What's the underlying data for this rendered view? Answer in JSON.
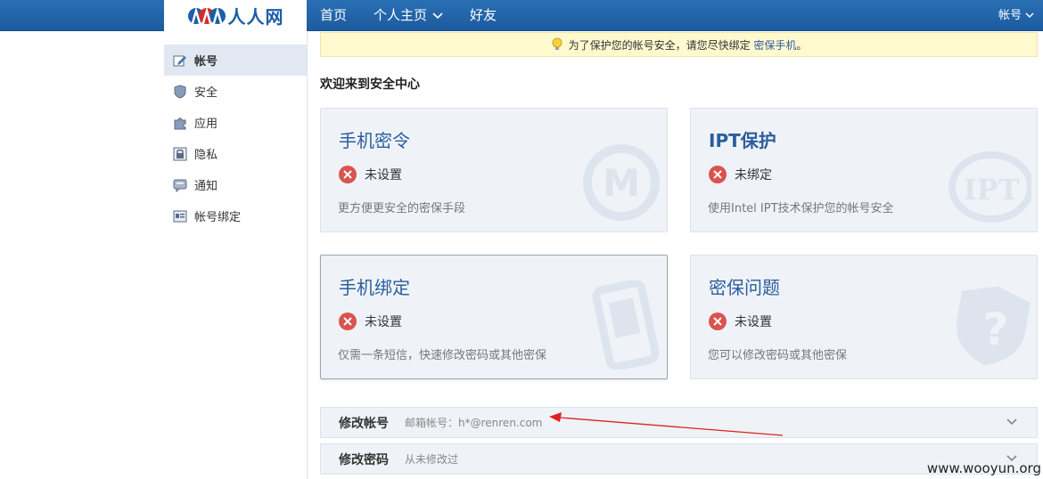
{
  "header": {
    "logo_text": "人人网",
    "nav": [
      {
        "label": "首页"
      },
      {
        "label": "个人主页"
      },
      {
        "label": "好友"
      }
    ],
    "account_label": "帐号"
  },
  "sidebar": {
    "items": [
      {
        "label": "帐号",
        "icon": "edit-icon",
        "active": true
      },
      {
        "label": "安全",
        "icon": "shield-icon"
      },
      {
        "label": "应用",
        "icon": "puzzle-icon"
      },
      {
        "label": "隐私",
        "icon": "lock-icon"
      },
      {
        "label": "通知",
        "icon": "message-icon"
      },
      {
        "label": "帐号绑定",
        "icon": "id-card-icon"
      }
    ]
  },
  "notice": {
    "text": "为了保护您的帐号安全，请您尽快绑定",
    "link": "密保手机",
    "suffix": "。"
  },
  "welcome": "欢迎来到安全中心",
  "cards": [
    {
      "title": "手机密令",
      "status": "未设置",
      "desc": "更方便更安全的密保手段",
      "watermark": "M"
    },
    {
      "title": "IPT保护",
      "status": "未绑定",
      "desc": "使用Intel IPT技术保护您的帐号安全",
      "watermark": "IPT"
    },
    {
      "title": "手机绑定",
      "status": "未设置",
      "desc": "仅需一条短信，快速修改密码或其他密保",
      "watermark": "phone"
    },
    {
      "title": "密保问题",
      "status": "未设置",
      "desc": "您可以修改密码或其他密保",
      "watermark": "?"
    }
  ],
  "rows": [
    {
      "title": "修改帐号",
      "sub": "邮箱帐号：h*@renren.com"
    },
    {
      "title": "修改密码",
      "sub": "从未修改过"
    }
  ],
  "annotation": {
    "color": "#e02020"
  },
  "watermark": "www.wooyun.org",
  "colors": {
    "topbar": "#1c5b9f",
    "title_blue": "#2b5e9c",
    "error_red": "#d9534f"
  }
}
